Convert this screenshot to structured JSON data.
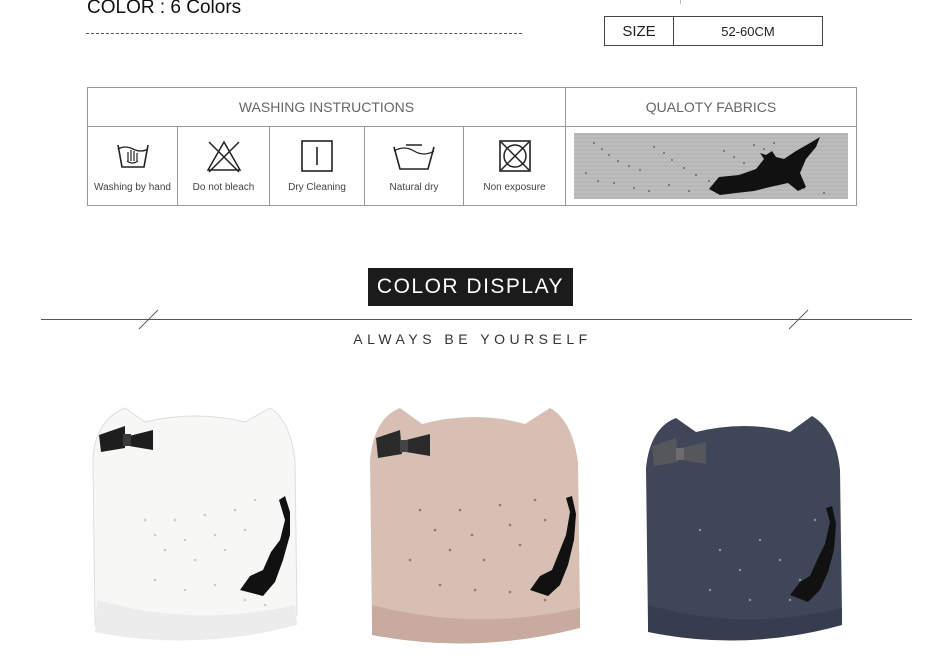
{
  "spec": {
    "color_line": "COLOR :  6 Colors",
    "size_label": "SIZE",
    "size_value": "52-60CM"
  },
  "care": {
    "washing_title": "WASHING INSTRUCTIONS",
    "fabric_title": "QUALOTY FABRICS",
    "items": [
      {
        "label": "Washing by hand",
        "icon": "hand-wash-icon"
      },
      {
        "label": "Do not bleach",
        "icon": "no-bleach-icon"
      },
      {
        "label": "Dry Cleaning",
        "icon": "dry-clean-icon"
      },
      {
        "label": "Natural dry",
        "icon": "natural-dry-icon"
      },
      {
        "label": "Non exposure",
        "icon": "no-tumble-dry-icon"
      }
    ]
  },
  "display": {
    "title": "COLOR DISPLAY",
    "tagline": "ALWAYS BE YOURSELF"
  },
  "colors": {
    "hat_white": "#f7f7f6",
    "hat_pink": "#d7bfb4",
    "hat_navy": "#3f4658",
    "badge": "#1b1b1b"
  }
}
